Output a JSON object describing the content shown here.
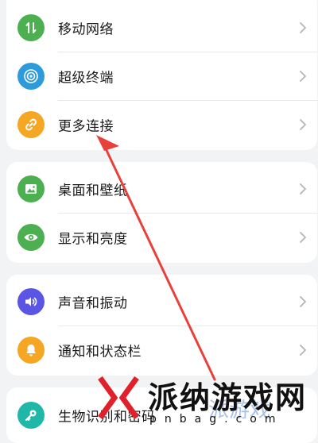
{
  "groups": [
    {
      "items": [
        {
          "label": "移动网络",
          "icon": "mobile-data-icon",
          "color": "#4caf50"
        },
        {
          "label": "超级终端",
          "icon": "super-device-icon",
          "color": "#2d9bdb"
        },
        {
          "label": "更多连接",
          "icon": "link-icon",
          "color": "#f5a623"
        }
      ]
    },
    {
      "items": [
        {
          "label": "桌面和壁纸",
          "icon": "wallpaper-icon",
          "color": "#4caf50"
        },
        {
          "label": "显示和亮度",
          "icon": "eye-icon",
          "color": "#4caf50"
        }
      ]
    },
    {
      "items": [
        {
          "label": "声音和振动",
          "icon": "speaker-icon",
          "color": "#5b55e6"
        },
        {
          "label": "通知和状态栏",
          "icon": "bell-icon",
          "color": "#f5a623"
        }
      ]
    },
    {
      "items": [
        {
          "label": "生物识别和密码",
          "icon": "key-icon",
          "color": "#1fb8a8"
        }
      ]
    }
  ],
  "watermark": {
    "text": "派纳游戏网",
    "sub": "pnbag.com",
    "ghost": "派游戏"
  }
}
